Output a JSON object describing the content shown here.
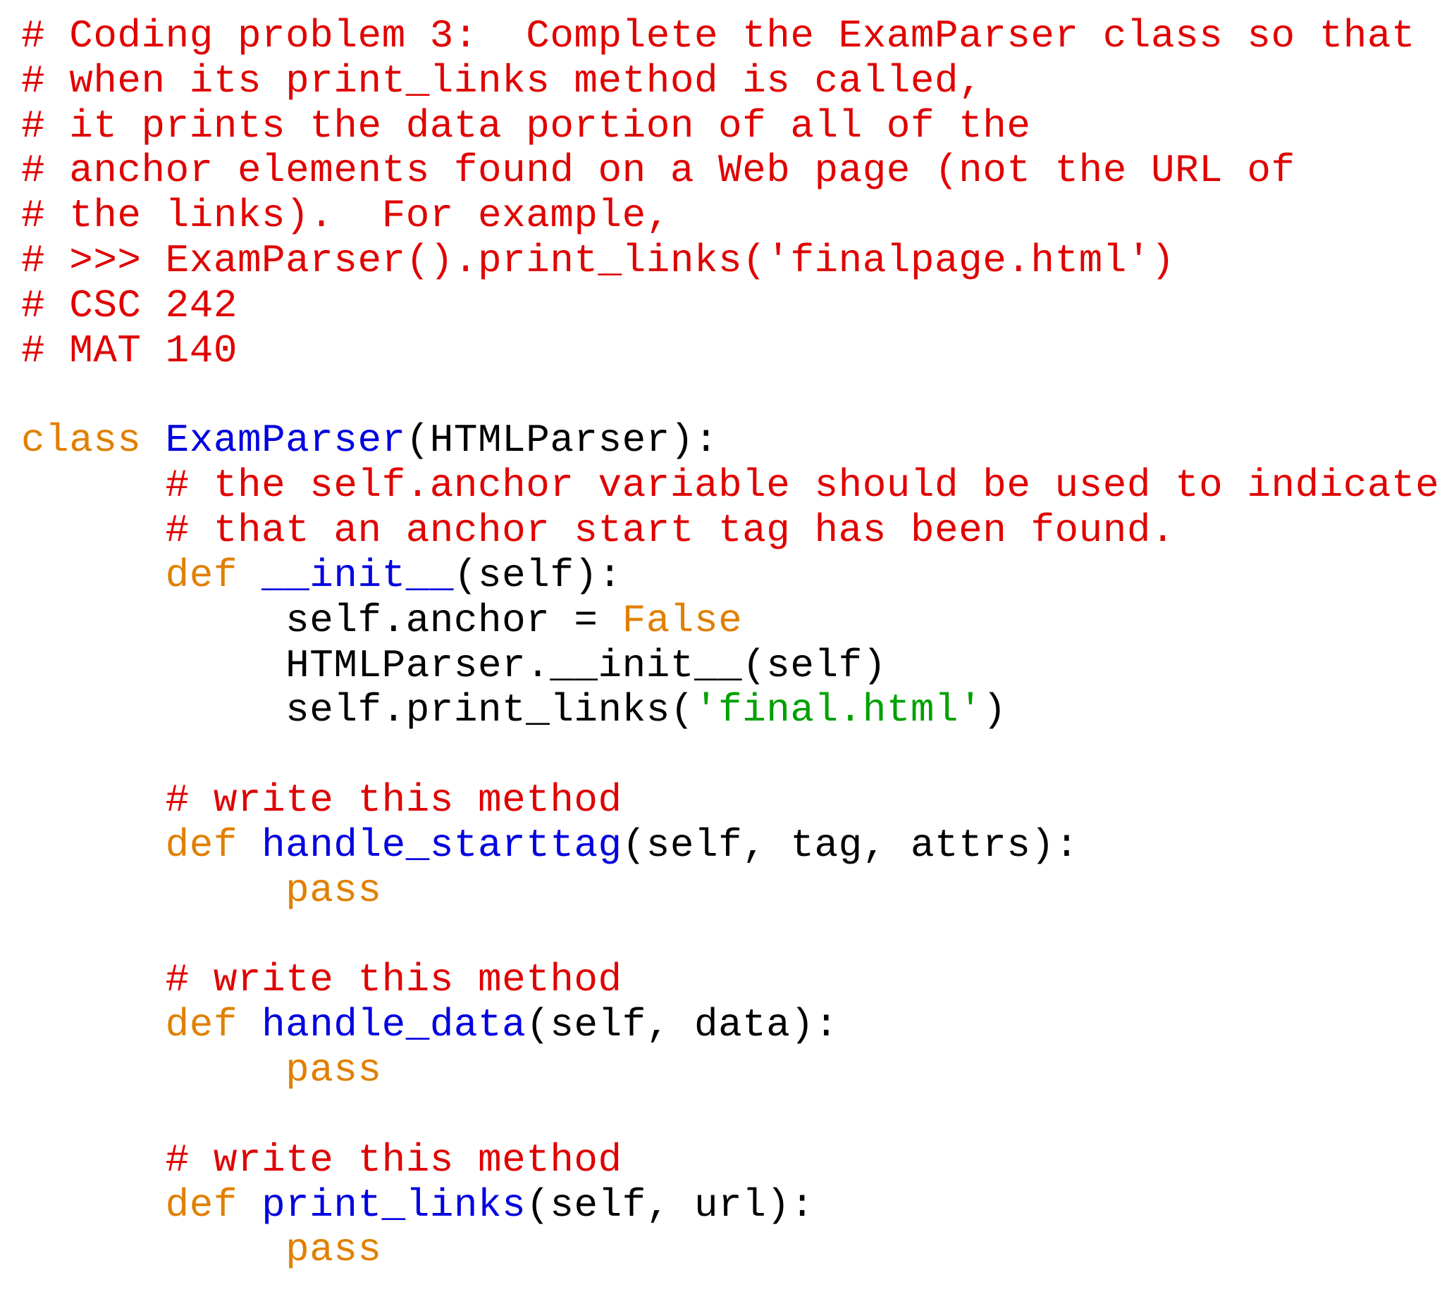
{
  "tokens": [
    {
      "cls": "c",
      "text": "# Coding problem 3:  Complete the ExamParser class so that\n# when its print_links method is called,\n# it prints the data portion of all of the\n# anchor elements found on a Web page (not the URL of\n# the links).  For example,\n# >>> ExamParser().print_links('finalpage.html')\n# CSC 242\n# MAT 140"
    },
    {
      "cls": "pl",
      "text": "\n\n"
    },
    {
      "cls": "kw",
      "text": "class"
    },
    {
      "cls": "pl",
      "text": " "
    },
    {
      "cls": "fn",
      "text": "ExamParser"
    },
    {
      "cls": "pl",
      "text": "(HTMLParser):\n      "
    },
    {
      "cls": "c",
      "text": "# the self.anchor variable should be used to indicate\n      # that an anchor start tag has been found."
    },
    {
      "cls": "pl",
      "text": "\n      "
    },
    {
      "cls": "kw",
      "text": "def"
    },
    {
      "cls": "pl",
      "text": " "
    },
    {
      "cls": "fn",
      "text": "__init__"
    },
    {
      "cls": "pl",
      "text": "(self):\n           self.anchor = "
    },
    {
      "cls": "kw",
      "text": "False"
    },
    {
      "cls": "pl",
      "text": "\n           HTMLParser.__init__(self)\n           self.print_links("
    },
    {
      "cls": "st",
      "text": "'final.html'"
    },
    {
      "cls": "pl",
      "text": ")\n\n      "
    },
    {
      "cls": "c",
      "text": "# write this method"
    },
    {
      "cls": "pl",
      "text": "\n      "
    },
    {
      "cls": "kw",
      "text": "def"
    },
    {
      "cls": "pl",
      "text": " "
    },
    {
      "cls": "fn",
      "text": "handle_starttag"
    },
    {
      "cls": "pl",
      "text": "(self, tag, attrs):\n           "
    },
    {
      "cls": "kw",
      "text": "pass"
    },
    {
      "cls": "pl",
      "text": "\n\n      "
    },
    {
      "cls": "c",
      "text": "# write this method"
    },
    {
      "cls": "pl",
      "text": "\n      "
    },
    {
      "cls": "kw",
      "text": "def"
    },
    {
      "cls": "pl",
      "text": " "
    },
    {
      "cls": "fn",
      "text": "handle_data"
    },
    {
      "cls": "pl",
      "text": "(self, data):\n           "
    },
    {
      "cls": "kw",
      "text": "pass"
    },
    {
      "cls": "pl",
      "text": "\n\n      "
    },
    {
      "cls": "c",
      "text": "# write this method"
    },
    {
      "cls": "pl",
      "text": "\n      "
    },
    {
      "cls": "kw",
      "text": "def"
    },
    {
      "cls": "pl",
      "text": " "
    },
    {
      "cls": "fn",
      "text": "print_links"
    },
    {
      "cls": "pl",
      "text": "(self, url):\n           "
    },
    {
      "cls": "kw",
      "text": "pass"
    },
    {
      "cls": "pl",
      "text": "\n"
    }
  ]
}
